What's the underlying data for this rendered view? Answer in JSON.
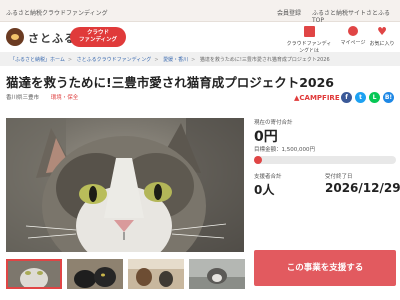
{
  "top_bar": {
    "tagline": "ふるさと納税クラウドファンディング",
    "register": "会員登録",
    "top_link": "ふるさと納税サイトさとふるTOP"
  },
  "header": {
    "logo_text": "さとふる",
    "badge_line1": "クラウド",
    "badge_line2": "ファンディング",
    "nav": [
      {
        "label": "クラウドファンディングとは"
      },
      {
        "label": "マイページ"
      },
      {
        "label": "お気に入り"
      }
    ]
  },
  "breadcrumb": [
    "「ふるさと納税」ホーム",
    "さとふるクラウドファンディング",
    "愛媛・香川",
    "猫達を救うために!三豊市愛され猫育成プロジェクト2026"
  ],
  "project": {
    "title": "猫達を救うために!三豊市愛され猫育成プロジェクト2026",
    "municipality": "香川県三豊市",
    "category": "環境・保全",
    "platform": "CAMPFIRE"
  },
  "share": {
    "fb": "f",
    "tw": "t",
    "line": "L",
    "hb": "B!"
  },
  "funding": {
    "current_label": "現在の寄付合計",
    "current_amount": "0円",
    "goal_label": "目標金額：1,500,000円",
    "progress_fraction": 0.0,
    "progress_text": "0%",
    "supporters_label": "支援者合計",
    "supporters_value": "0人",
    "deadline_label": "受付終了日",
    "deadline_value": "2026/12/29"
  },
  "cta": {
    "label": "この事業を支援する"
  },
  "colors": {
    "accent": "#e04545",
    "cta": "#e25a5f",
    "link": "#3a6ab0"
  }
}
